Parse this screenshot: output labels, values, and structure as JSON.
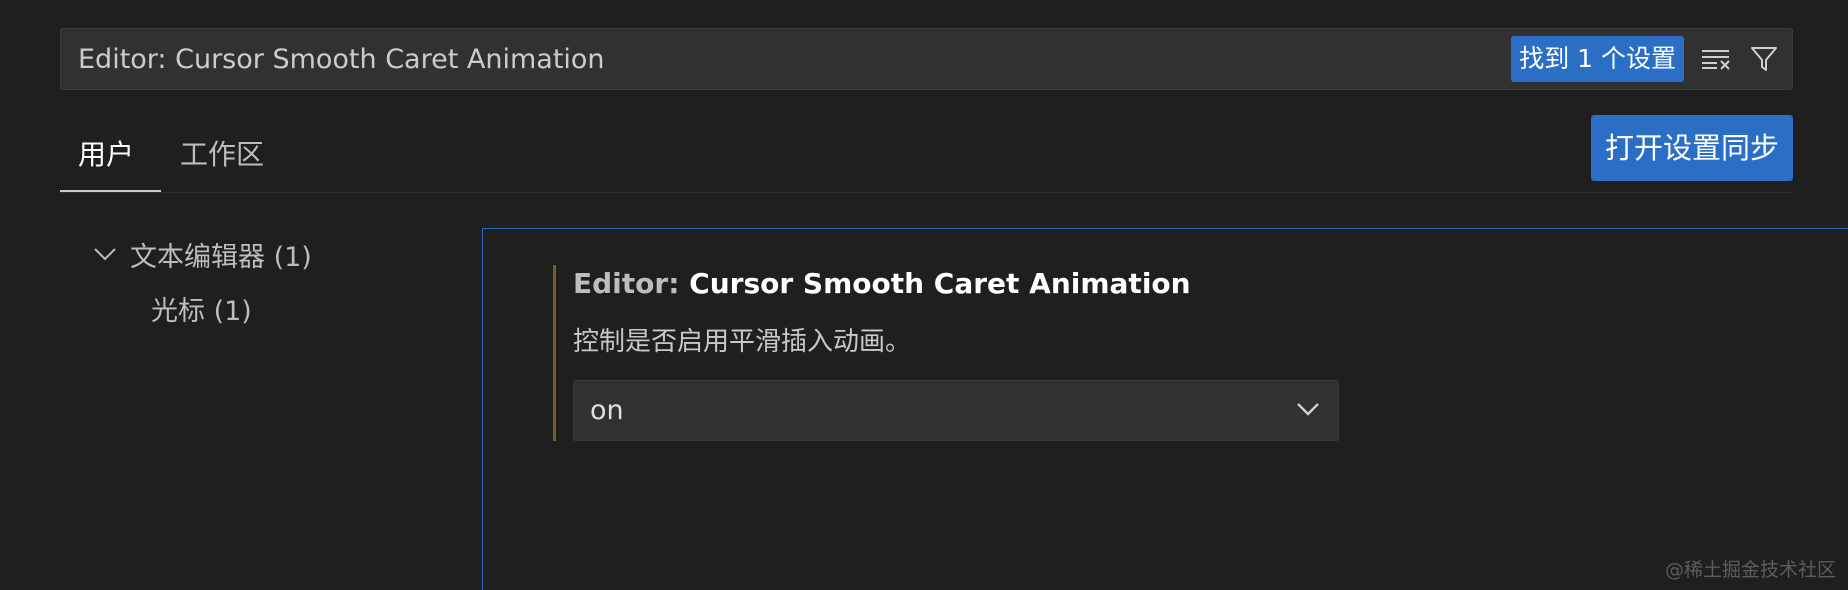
{
  "search": {
    "value": "Editor: Cursor Smooth Caret Animation",
    "results_badge": "找到 1 个设置",
    "clear_filter_icon": "clear-filter-icon",
    "filter_icon": "filter-icon"
  },
  "tabs": [
    {
      "label": "用户",
      "active": true
    },
    {
      "label": "工作区",
      "active": false
    }
  ],
  "sync_button_label": "打开设置同步",
  "tree": {
    "group": {
      "label": "文本编辑器 (1)",
      "expanded": true,
      "icon": "chevron-down-icon"
    },
    "children": [
      {
        "label": "光标 (1)"
      }
    ]
  },
  "setting": {
    "category": "Editor: ",
    "name": "Cursor Smooth Caret Animation",
    "description": "控制是否启用平滑插入动画。",
    "value": "on"
  },
  "watermark": "@稀土掘金技术社区",
  "colors": {
    "background": "#1f1f1f",
    "accent": "#2a6fc5",
    "panel_border": "#2d6ac4",
    "modified_indicator": "#7a5a2a"
  }
}
